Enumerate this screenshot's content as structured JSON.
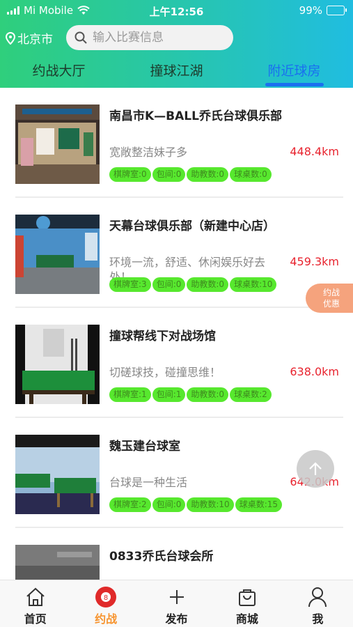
{
  "status_bar": {
    "carrier": "Mi Mobile",
    "time": "上午12:56",
    "battery": "99%"
  },
  "header": {
    "city": "北京市",
    "search_placeholder": "输入比赛信息",
    "tabs": [
      {
        "label": "约战大厅",
        "active": false
      },
      {
        "label": "撞球江湖",
        "active": false
      },
      {
        "label": "附近球房",
        "active": true
      }
    ]
  },
  "venues": [
    {
      "name": "南昌市K—BALL乔氏台球俱乐部",
      "desc": "宽敞整洁妹子多",
      "distance": "448.4km",
      "tags": [
        "棋牌室:0",
        "包间:0",
        "助教数:0",
        "球桌数:0"
      ]
    },
    {
      "name": "天幕台球俱乐部（新建中心店）",
      "desc": "环境一流，舒适、休闲娱乐好去处！",
      "distance": "459.3km",
      "tags": [
        "棋牌室:3",
        "包间:0",
        "助教数:0",
        "球桌数:10"
      ]
    },
    {
      "name": "撞球帮线下对战场馆",
      "desc": "切磋球技，碰撞思维！",
      "distance": "638.0km",
      "tags": [
        "棋牌室:1",
        "包间:1",
        "助教数:0",
        "球桌数:2"
      ]
    },
    {
      "name": "魏玉建台球室",
      "desc": "台球是一种生活",
      "distance": "642.0km",
      "tags": [
        "棋牌室:2",
        "包间:0",
        "助教数:10",
        "球桌数:15"
      ]
    },
    {
      "name": "0833乔氏台球会所",
      "desc": "",
      "distance": "",
      "tags": []
    }
  ],
  "promo": {
    "line1": "约战",
    "line2": "优惠"
  },
  "bottom_nav": [
    {
      "label": "首页",
      "icon": "home-icon",
      "active": false
    },
    {
      "label": "约战",
      "icon": "billiard-ball-icon",
      "active": true
    },
    {
      "label": "发布",
      "icon": "plus-icon",
      "active": false
    },
    {
      "label": "商城",
      "icon": "shopping-bag-icon",
      "active": false
    },
    {
      "label": "我",
      "icon": "user-icon",
      "active": false
    }
  ],
  "colors": {
    "header_start": "#2fcf7c",
    "header_end": "#20bde0",
    "active_tab": "#1a6ff0",
    "distance": "#e8232e",
    "tag_bg": "#57e82e",
    "nav_active": "#f7942f"
  }
}
